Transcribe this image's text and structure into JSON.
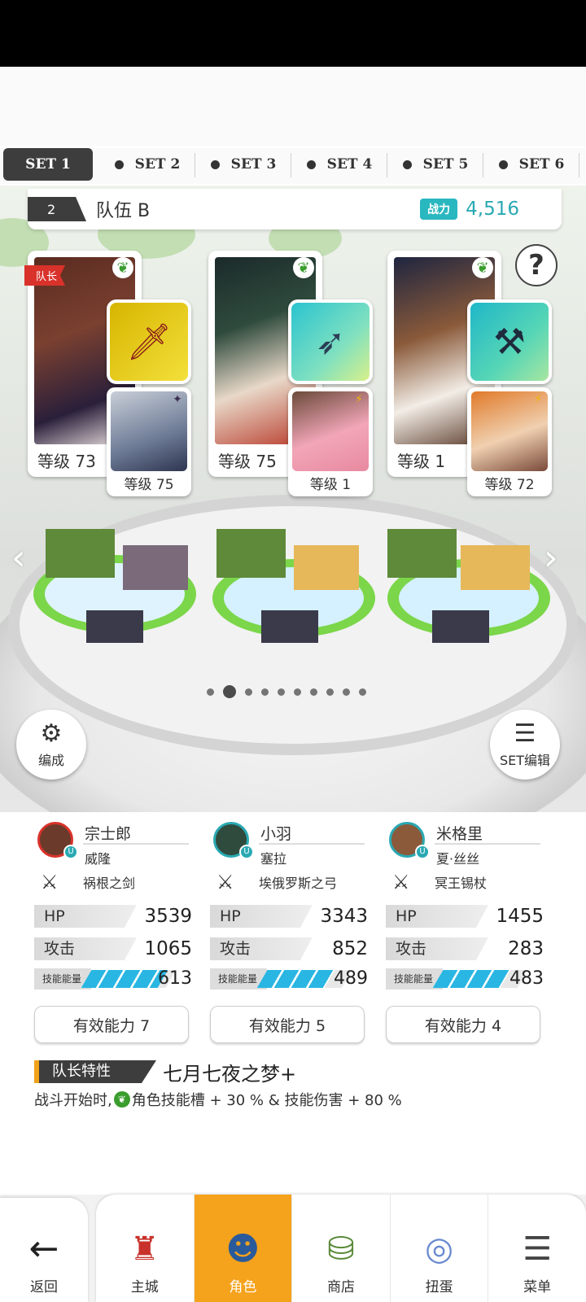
{
  "set_tabs": [
    {
      "label": "SET 1",
      "active": true
    },
    {
      "label": "SET 2",
      "active": false
    },
    {
      "label": "SET 3",
      "active": false
    },
    {
      "label": "SET 4",
      "active": false
    },
    {
      "label": "SET 5",
      "active": false
    },
    {
      "label": "SET 6",
      "active": false
    }
  ],
  "team": {
    "number": "2",
    "name": "队伍 B",
    "power_label": "战力",
    "power_value": "4,516"
  },
  "help_label": "?",
  "heroes": [
    {
      "leader_tag": "队长",
      "level": "等级 73",
      "sub_level": "等级 75",
      "avatar_name": "宗士郎",
      "sub_name": "威隆",
      "weapon": "祸根之剑",
      "hp": "3539",
      "atk": "1065",
      "energy": "613",
      "effect": "有效能力 7"
    },
    {
      "level": "等级 75",
      "sub_level": "等级 1",
      "avatar_name": "小羽",
      "sub_name": "塞拉",
      "weapon": "埃俄罗斯之弓",
      "hp": "3343",
      "atk": "852",
      "energy": "489",
      "effect": "有效能力 5"
    },
    {
      "level": "等级 1",
      "sub_level": "等级 72",
      "avatar_name": "米格里",
      "sub_name": "夏·丝丝",
      "weapon": "冥王锡杖",
      "hp": "1455",
      "atk": "283",
      "energy": "483",
      "effect": "有效能力 4"
    }
  ],
  "stat_labels": {
    "hp": "HP",
    "atk": "攻击",
    "energy": "技能能量"
  },
  "buttons": {
    "edit": "编成",
    "set_edit": "SET编辑"
  },
  "leader": {
    "label": "队长特性",
    "skill": "七月七夜之梦+",
    "desc_prefix": "战斗开始时,",
    "desc_suffix": "角色技能槽 + 30 % & 技能伤害 + 80 %"
  },
  "pager": {
    "pages": 10,
    "current": 2
  },
  "nav": {
    "back": "返回",
    "items": [
      {
        "label": "主城",
        "icon": "castle-icon",
        "active": false
      },
      {
        "label": "角色",
        "icon": "character-icon",
        "active": true
      },
      {
        "label": "商店",
        "icon": "shop-icon",
        "active": false
      },
      {
        "label": "扭蛋",
        "icon": "gacha-icon",
        "active": false
      },
      {
        "label": "菜单",
        "icon": "menu-icon",
        "active": false
      }
    ]
  },
  "colors": {
    "accent_teal": "#29b7c0",
    "active_nav": "#f5a21c",
    "leader_red": "#d9322b"
  }
}
